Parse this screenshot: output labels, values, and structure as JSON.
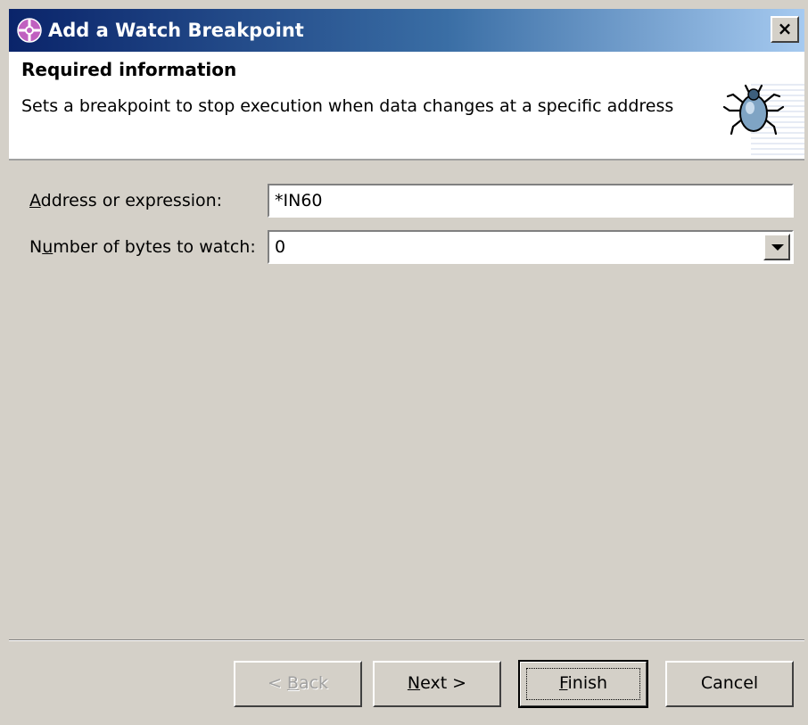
{
  "window": {
    "title": "Add a Watch Breakpoint",
    "close_label": "×"
  },
  "header": {
    "title": "Required information",
    "description": "Sets a breakpoint to stop execution when data changes at a specific address",
    "icon": "bug-icon"
  },
  "form": {
    "address_label_mnemonic": "A",
    "address_label_rest": "ddress or expression:",
    "address_value": "*IN60",
    "bytes_label_prefix": "N",
    "bytes_label_mnemonic": "u",
    "bytes_label_rest": "mber of bytes to watch:",
    "bytes_value": "0"
  },
  "buttons": {
    "back_prefix": "< ",
    "back_mnemonic": "B",
    "back_rest": "ack",
    "next_mnemonic": "N",
    "next_rest": "ext >",
    "finish_mnemonic": "F",
    "finish_rest": "inish",
    "cancel": "Cancel"
  },
  "colors": {
    "titlebar_start": "#0a246a",
    "titlebar_end": "#a6caf0",
    "dialog_bg": "#d4d0c8"
  }
}
